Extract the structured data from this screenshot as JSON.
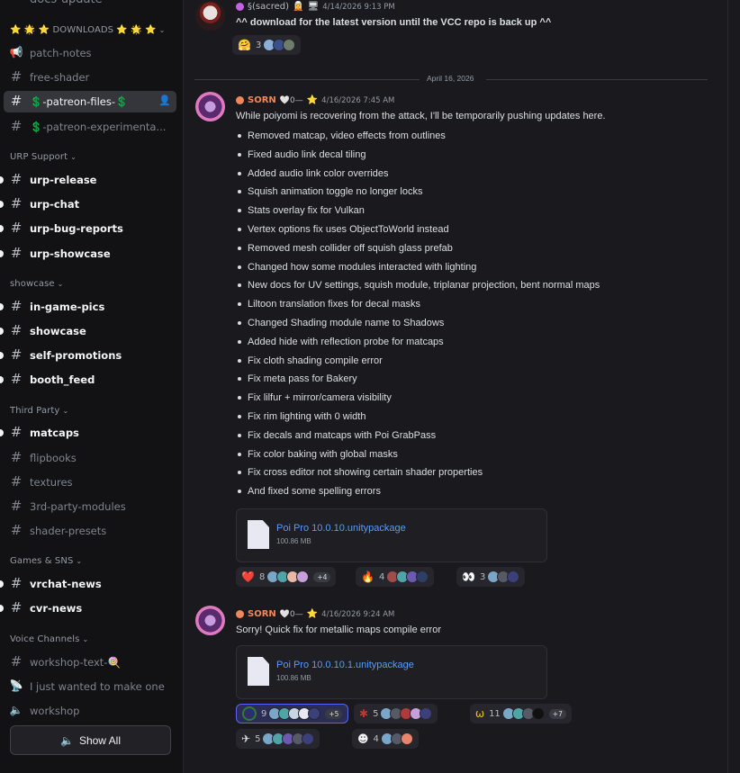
{
  "sidebar": {
    "top_partial": "docs-update",
    "categories": {
      "downloads": "⭐ 🌟 ⭐ DOWNLOADS ⭐ 🌟 ⭐",
      "urp": "URP Support",
      "showcase": "showcase",
      "third_party": "Third Party",
      "games": "Games & SNS",
      "voice": "Voice Channels"
    },
    "channels": {
      "patch_notes": "patch-notes",
      "free_shader": "free-shader",
      "patreon_files": "💲-patreon-files-💲",
      "patreon_exp": "💲-patreon-experimenta...",
      "urp_release": "urp-release",
      "urp_chat": "urp-chat",
      "urp_bug": "urp-bug-reports",
      "urp_showcase": "urp-showcase",
      "in_game_pics": "in-game-pics",
      "showcase": "showcase",
      "self_promotions": "self-promotions",
      "booth_feed": "booth_feed",
      "matcaps": "matcaps",
      "flipbooks": "flipbooks",
      "textures": "textures",
      "third_party_modules": "3rd-party-modules",
      "shader_presets": "shader-presets",
      "vrchat_news": "vrchat-news",
      "cvr_news": "cvr-news",
      "workshop_text": "workshop-text-🍭",
      "wanted_to_make": "I just wanted to make one",
      "workshop": "workshop"
    },
    "show_all": "Show All"
  },
  "messages": {
    "m1": {
      "username": "§(sacred)",
      "timestamp": "4/14/2026 9:13 PM",
      "text": "^^ download for the latest version until the VCC repo is back up ^^",
      "reaction_count": "3"
    },
    "date_divider": "April 16, 2026",
    "m2": {
      "username": "SORN",
      "tag": "🤍0—",
      "timestamp": "4/16/2026 7:45 AM",
      "intro": "While poiyomi is recovering from the attack, I'll be temporarily pushing updates here.",
      "bullets": [
        "Removed matcap, video effects from outlines",
        "Fixed audio link decal tiling",
        "Added audio link color overrides",
        "Squish animation toggle no longer locks",
        "Stats overlay fix for Vulkan",
        "Vertex options fix uses ObjectToWorld instead",
        "Removed mesh collider off squish glass prefab",
        "Changed how some modules interacted with lighting",
        "New docs for UV settings, squish module, triplanar projection, bent normal maps",
        "Liltoon translation fixes for decal masks",
        "Changed Shading module name to Shadows",
        "Added hide with reflection probe for matcaps",
        "Fix cloth shading compile error",
        "Fix meta pass for Bakery",
        "Fix lilfur + mirror/camera visibility",
        "Fix rim lighting with 0 width",
        "Fix decals and matcaps with Poi GrabPass",
        "Fix color baking with global masks",
        "Fix cross editor not showing certain shader properties",
        "And fixed some spelling errors"
      ],
      "attachment": {
        "name": "Poi Pro 10.0.10.unitypackage",
        "size": "100.86 MB"
      },
      "reactions": [
        {
          "emoji": "❤️",
          "count": "8",
          "more": "+4"
        },
        {
          "emoji": "🔥",
          "count": "4"
        },
        {
          "emoji": "👀",
          "count": "3"
        }
      ]
    },
    "m3": {
      "username": "SORN",
      "tag": "🤍0—",
      "timestamp": "4/16/2026 9:24 AM",
      "text": "Sorry! Quick fix for metallic maps compile error",
      "attachment": {
        "name": "Poi Pro 10.0.10.1.unitypackage",
        "size": "100.86 MB"
      },
      "reactions_row1": [
        {
          "count": "9",
          "more": "+5"
        },
        {
          "count": "5"
        },
        {
          "count": "11",
          "more": "+7"
        }
      ],
      "reactions_row2": [
        {
          "count": "5"
        },
        {
          "count": "4"
        }
      ]
    }
  },
  "colors": {
    "sorn": "#f0875a",
    "sacred": "#b5bac1",
    "link": "#5a9cf8",
    "accent": "#5865f2"
  }
}
